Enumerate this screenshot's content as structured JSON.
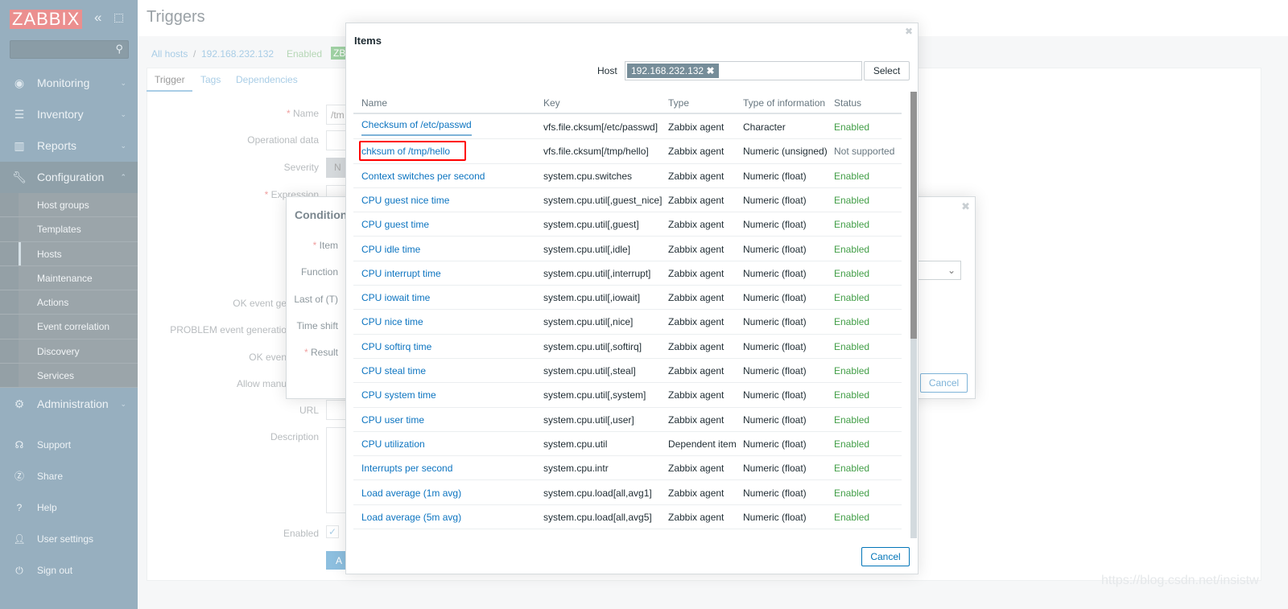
{
  "sidebar": {
    "logo": "ZABBIX",
    "collapse_icon": "double-chevron-left",
    "kiosk_icon": "fullscreen",
    "search_placeholder": "",
    "menu": [
      {
        "label": "Monitoring",
        "icon": "eye"
      },
      {
        "label": "Inventory",
        "icon": "list"
      },
      {
        "label": "Reports",
        "icon": "bar-chart"
      },
      {
        "label": "Configuration",
        "icon": "wrench"
      }
    ],
    "config_sub": [
      "Host groups",
      "Templates",
      "Hosts",
      "Maintenance",
      "Actions",
      "Event correlation",
      "Discovery",
      "Services"
    ],
    "admin": {
      "label": "Administration",
      "icon": "gear"
    },
    "footer": [
      {
        "label": "Support",
        "icon": "headset"
      },
      {
        "label": "Share",
        "icon": "z-box"
      },
      {
        "label": "Help",
        "icon": "question"
      },
      {
        "label": "User settings",
        "icon": "user"
      },
      {
        "label": "Sign out",
        "icon": "power"
      }
    ]
  },
  "page": {
    "title": "Triggers",
    "breadcrumb": [
      "All hosts",
      "192.168.232.132"
    ],
    "host_status": "Enabled",
    "zbx_badge": "ZB",
    "tabs": [
      "Trigger",
      "Tags",
      "Dependencies"
    ],
    "form_labels": {
      "name": "Name",
      "opdata": "Operational data",
      "severity": "Severity",
      "expression": "Expression",
      "ok_gen": "OK event ge",
      "problem_gen": "PROBLEM event generatio",
      "ok_close": "OK even",
      "allow_manual": "Allow manu",
      "url": "URL",
      "description": "Description",
      "enabled": "Enabled"
    },
    "name_value": "/tm",
    "severity_value": "N",
    "add_button": "A"
  },
  "condition": {
    "title": "Condition",
    "labels": [
      "Item",
      "Function",
      "Last of (T)",
      "Time shift",
      "Result"
    ],
    "cancel": "Cancel"
  },
  "items_modal": {
    "title": "Items",
    "host_label": "Host",
    "host_tag": "192.168.232.132",
    "select": "Select",
    "cancel": "Cancel",
    "columns": [
      "Name",
      "Key",
      "Type",
      "Type of information",
      "Status"
    ],
    "rows": [
      [
        "Checksum of /etc/passwd",
        "vfs.file.cksum[/etc/passwd]",
        "Zabbix agent",
        "Character",
        "Enabled"
      ],
      [
        "chksum of /tmp/hello",
        "vfs.file.cksum[/tmp/hello]",
        "Zabbix agent",
        "Numeric (unsigned)",
        "Not supported"
      ],
      [
        "Context switches per second",
        "system.cpu.switches",
        "Zabbix agent",
        "Numeric (float)",
        "Enabled"
      ],
      [
        "CPU guest nice time",
        "system.cpu.util[,guest_nice]",
        "Zabbix agent",
        "Numeric (float)",
        "Enabled"
      ],
      [
        "CPU guest time",
        "system.cpu.util[,guest]",
        "Zabbix agent",
        "Numeric (float)",
        "Enabled"
      ],
      [
        "CPU idle time",
        "system.cpu.util[,idle]",
        "Zabbix agent",
        "Numeric (float)",
        "Enabled"
      ],
      [
        "CPU interrupt time",
        "system.cpu.util[,interrupt]",
        "Zabbix agent",
        "Numeric (float)",
        "Enabled"
      ],
      [
        "CPU iowait time",
        "system.cpu.util[,iowait]",
        "Zabbix agent",
        "Numeric (float)",
        "Enabled"
      ],
      [
        "CPU nice time",
        "system.cpu.util[,nice]",
        "Zabbix agent",
        "Numeric (float)",
        "Enabled"
      ],
      [
        "CPU softirq time",
        "system.cpu.util[,softirq]",
        "Zabbix agent",
        "Numeric (float)",
        "Enabled"
      ],
      [
        "CPU steal time",
        "system.cpu.util[,steal]",
        "Zabbix agent",
        "Numeric (float)",
        "Enabled"
      ],
      [
        "CPU system time",
        "system.cpu.util[,system]",
        "Zabbix agent",
        "Numeric (float)",
        "Enabled"
      ],
      [
        "CPU user time",
        "system.cpu.util[,user]",
        "Zabbix agent",
        "Numeric (float)",
        "Enabled"
      ],
      [
        "CPU utilization",
        "system.cpu.util",
        "Dependent item",
        "Numeric (float)",
        "Enabled"
      ],
      [
        "Interrupts per second",
        "system.cpu.intr",
        "Zabbix agent",
        "Numeric (float)",
        "Enabled"
      ],
      [
        "Load average (1m avg)",
        "system.cpu.load[all,avg1]",
        "Zabbix agent",
        "Numeric (float)",
        "Enabled"
      ],
      [
        "Load average (5m avg)",
        "system.cpu.load[all,avg5]",
        "Zabbix agent",
        "Numeric (float)",
        "Enabled"
      ]
    ],
    "highlighted_row": 1,
    "highlight_color": "#ff0000"
  },
  "watermark": "https://blog.csdn.net/insistw",
  "colors": {
    "link": "#0c74c0",
    "enabled": "#429e47",
    "sidebar": "#97afbf"
  }
}
